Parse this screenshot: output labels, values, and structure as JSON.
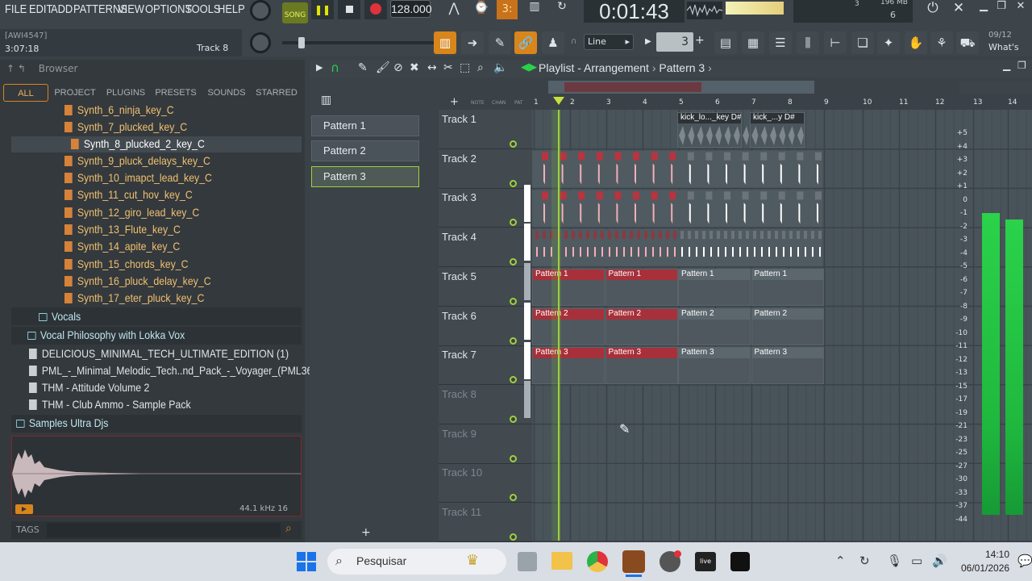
{
  "menu": [
    "FILE",
    "EDIT",
    "ADD",
    "PATTERNS",
    "VIEW",
    "OPTIONS",
    "TOOLS",
    "HELP"
  ],
  "transport": {
    "song": "SONG",
    "bpm": "128.000",
    "time": "0:01:43",
    "memory": "196 MB",
    "polyphony": "6",
    "cpu": "3",
    "snap": "Line",
    "step": "3",
    "news": "09/12",
    "news_title": "What's"
  },
  "hint": {
    "code": "[AWI4547]",
    "time": "3:07:18",
    "target": "Track 8"
  },
  "browser": {
    "title": "Browser",
    "tabs": [
      "ALL",
      "PROJECT",
      "PLUGINS",
      "PRESETS",
      "SOUNDS",
      "STARRED"
    ],
    "synths": [
      "Synth_6_ninja_key_C",
      "Synth_7_plucked_key_C",
      "Synth_8_plucked_2_key_C",
      "Synth_9_pluck_delays_key_C",
      "Synth_10_imapct_lead_key_C",
      "Synth_11_cut_hov_key_C",
      "Synth_12_giro_lead_key_C",
      "Synth_13_Flute_key_C",
      "Synth_14_apite_key_C",
      "Synth_15_chords_key_C",
      "Synth_16_pluck_delay_key_C",
      "Synth_17_eter_pluck_key_C"
    ],
    "folders": [
      "Vocals",
      "Vocal Philosophy with Lokka Vox"
    ],
    "packs": [
      "DELICIOUS_MINIMAL_TECH_ULTIMATE_EDITION (1)",
      "PML_-_Minimal_Melodic_Tech..nd_Pack_-_Voyager_(PML360)",
      "THM - Attitude Volume 2",
      "THM - Club Ammo - Sample Pack"
    ],
    "samples_folder": "Samples Ultra Djs",
    "sample_info": "44.1 kHz 16",
    "tags": "TAGS"
  },
  "playlist": {
    "breadcrumb": "Playlist - Arrangement",
    "pattern": "Pattern 3",
    "patterns": [
      "Pattern 1",
      "Pattern 2",
      "Pattern 3"
    ],
    "bars": [
      "1",
      "2",
      "3",
      "4",
      "5",
      "6",
      "7",
      "8",
      "9",
      "10",
      "11",
      "12",
      "13",
      "14"
    ],
    "tracks": [
      "Track 1",
      "Track 2",
      "Track 3",
      "Track 4",
      "Track 5",
      "Track 6",
      "Track 7",
      "Track 8",
      "Track 9",
      "Track 10",
      "Track 11"
    ],
    "kick_clips": [
      "kick_lo..._key D#",
      "kick_...y D#"
    ],
    "db": [
      "+5",
      "+4",
      "+3",
      "+2",
      "+1",
      "0",
      "-1",
      "-2",
      "-3",
      "-4",
      "-5",
      "-6",
      "-7",
      "-8",
      "-9",
      "-10",
      "-11",
      "-12",
      "-13",
      "-15",
      "-17",
      "-19",
      "-21",
      "-23",
      "-25",
      "-27",
      "-30",
      "-33",
      "-37",
      "-44"
    ]
  },
  "taskbar": {
    "search": "Pesquisar",
    "time": "14:10",
    "date": "06/01/2026"
  },
  "colors": {
    "accent": "#ffa500",
    "record": "#e0323a",
    "clip_red": "#a8303a",
    "meter": "#2bd24a"
  }
}
